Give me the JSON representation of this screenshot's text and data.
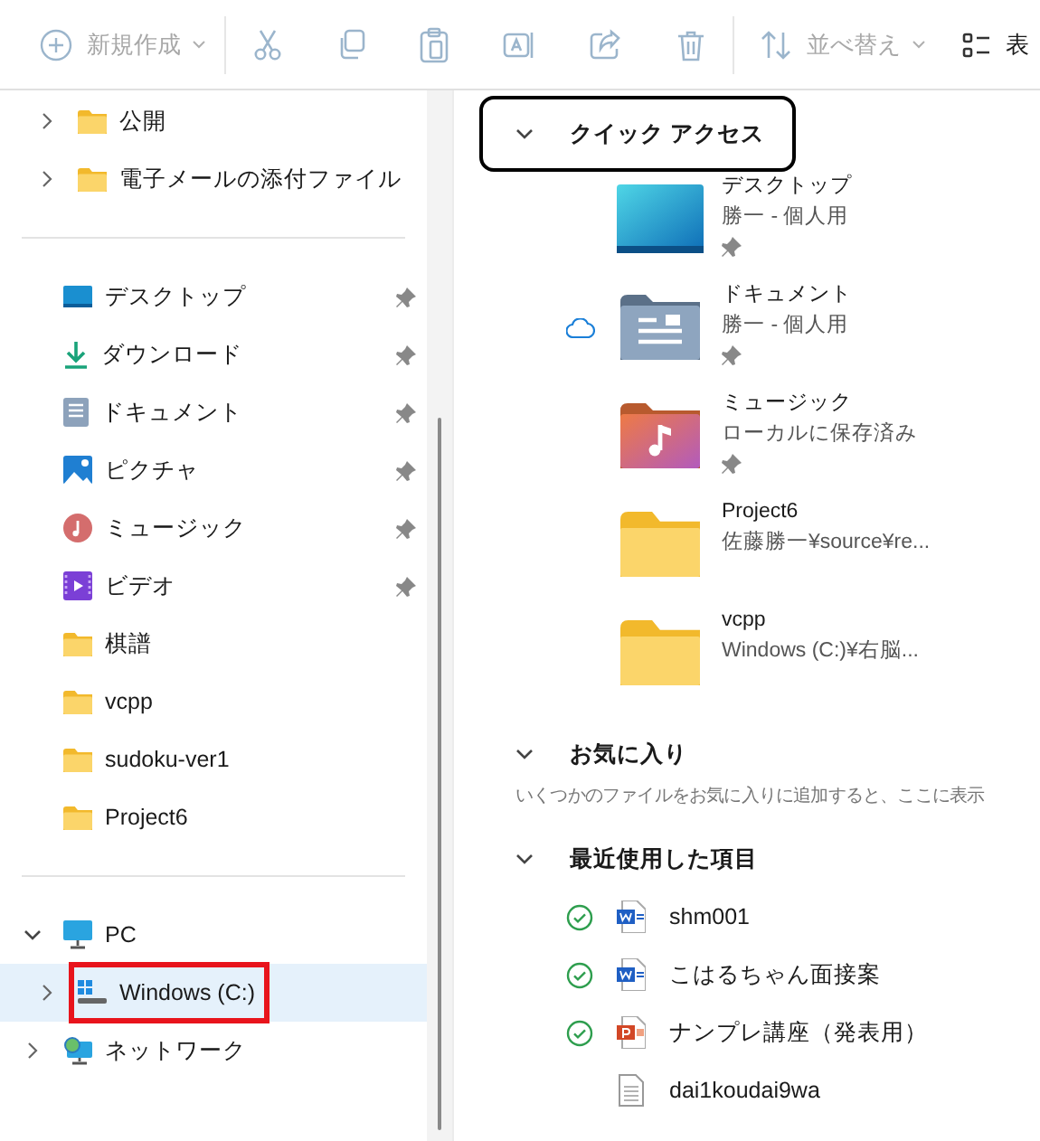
{
  "toolbar": {
    "buttons": [
      {
        "kind": "new",
        "label": "新規作成",
        "disabled": true
      },
      {
        "kind": "cut",
        "disabled": true
      },
      {
        "kind": "copy",
        "disabled": true
      },
      {
        "kind": "paste",
        "disabled": true
      },
      {
        "kind": "rename",
        "disabled": true
      },
      {
        "kind": "share",
        "disabled": true
      },
      {
        "kind": "delete",
        "disabled": true
      },
      {
        "kind": "sort",
        "label": "並べ替え",
        "disabled": true
      },
      {
        "kind": "view",
        "label": "表",
        "disabled": false
      }
    ]
  },
  "sidebar": {
    "sections": [
      {
        "kind": "subfolders",
        "items": [
          {
            "label": "公開",
            "kind": "folder",
            "expanded": false,
            "selected": false
          },
          {
            "label": "電子メールの添付ファイル",
            "kind": "folder",
            "expanded": false,
            "selected": false
          }
        ]
      },
      {
        "kind": "quick",
        "items": [
          {
            "label": "デスクトップ",
            "kind": "desktop",
            "pinned": true,
            "selected": false
          },
          {
            "label": "ダウンロード",
            "kind": "download",
            "pinned": true,
            "selected": false
          },
          {
            "label": "ドキュメント",
            "kind": "document",
            "pinned": true,
            "selected": false
          },
          {
            "label": "ピクチャ",
            "kind": "picture",
            "pinned": true,
            "selected": false
          },
          {
            "label": "ミュージック",
            "kind": "music",
            "pinned": true,
            "selected": false
          },
          {
            "label": "ビデオ",
            "kind": "video",
            "pinned": true,
            "selected": false
          },
          {
            "label": "棋譜",
            "kind": "folder",
            "pinned": false,
            "selected": false
          },
          {
            "label": "vcpp",
            "kind": "folder",
            "pinned": false,
            "selected": false
          },
          {
            "label": "sudoku-ver1",
            "kind": "folder",
            "pinned": false,
            "selected": false
          },
          {
            "label": "Project6",
            "kind": "folder",
            "pinned": false,
            "selected": false
          }
        ]
      },
      {
        "kind": "tree",
        "items": [
          {
            "label": "PC",
            "kind": "pc",
            "expanded": true,
            "selected": false,
            "children": [
              {
                "label": "Windows (C:)",
                "kind": "drive",
                "expanded": false,
                "selected": true,
                "annotated": true
              }
            ]
          },
          {
            "label": "ネットワーク",
            "kind": "network",
            "expanded": false,
            "selected": false
          }
        ]
      }
    ]
  },
  "content": {
    "sections": [
      {
        "title": "クイック アクセス",
        "expanded": true,
        "focused": true,
        "kind": "tiles",
        "items": [
          {
            "name": "デスクトップ",
            "detail": "勝一 - 個人用",
            "kind": "desktop",
            "pinned": true,
            "cloud": false
          },
          {
            "name": "ドキュメント",
            "detail": "勝一 - 個人用",
            "kind": "document",
            "pinned": true,
            "cloud": true
          },
          {
            "name": "ミュージック",
            "detail": "ローカルに保存済み",
            "kind": "music",
            "pinned": true,
            "cloud": false
          },
          {
            "name": "Project6",
            "detail": "佐藤勝一¥source¥re...",
            "kind": "folder",
            "pinned": false,
            "cloud": false
          },
          {
            "name": "vcpp",
            "detail": "Windows (C:)¥右脳...",
            "kind": "folder",
            "pinned": false,
            "cloud": false
          }
        ]
      },
      {
        "title": "お気に入り",
        "expanded": true,
        "focused": false,
        "kind": "empty",
        "message": "いくつかのファイルをお気に入りに追加すると、ここに表示"
      },
      {
        "title": "最近使用した項目",
        "expanded": true,
        "focused": false,
        "kind": "list",
        "items": [
          {
            "name": "shm001",
            "kind": "word",
            "synced": true
          },
          {
            "name": "こはるちゃん面接案",
            "kind": "word",
            "synced": true
          },
          {
            "name": "ナンプレ講座（発表用）",
            "kind": "powerpoint",
            "synced": true
          },
          {
            "name": "dai1koudai9wa",
            "kind": "text",
            "synced": false
          }
        ]
      }
    ]
  }
}
